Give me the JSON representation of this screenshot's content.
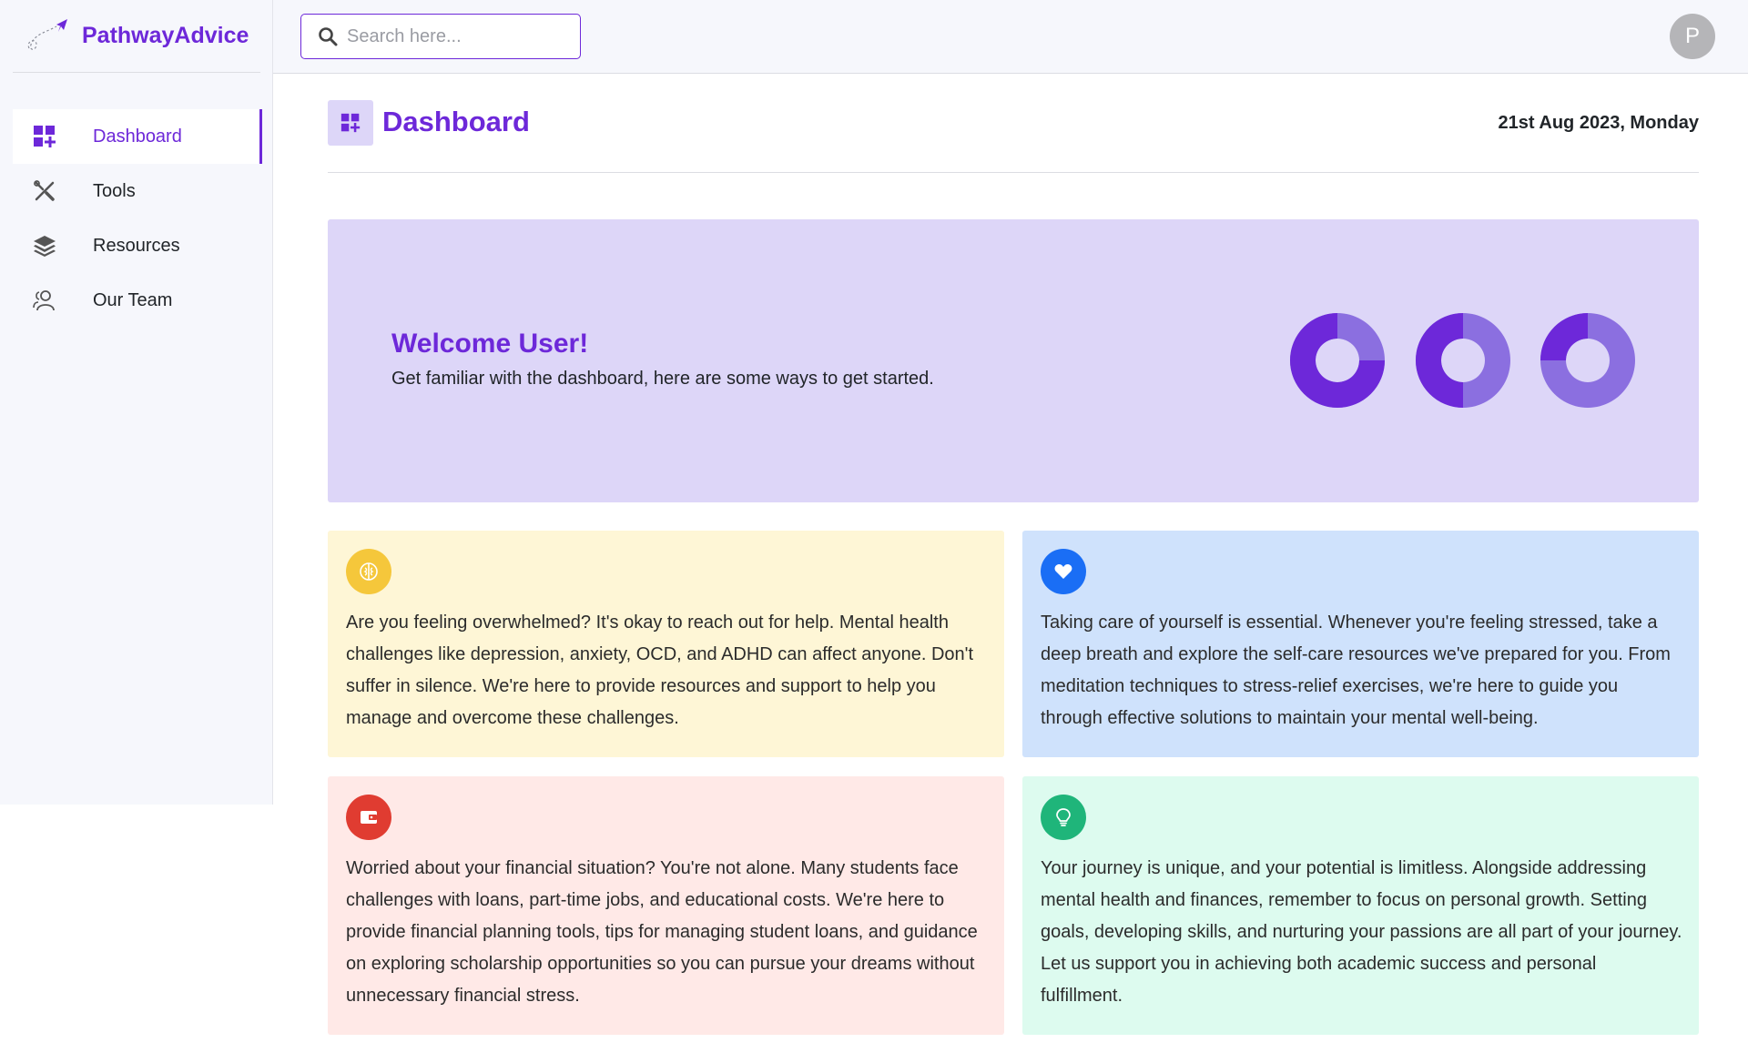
{
  "brand": {
    "name": "PathwayAdvice"
  },
  "sidebar": {
    "items": [
      {
        "label": "Dashboard",
        "icon": "dashboard-icon",
        "active": true
      },
      {
        "label": "Tools",
        "icon": "tools-icon",
        "active": false
      },
      {
        "label": "Resources",
        "icon": "layers-icon",
        "active": false
      },
      {
        "label": "Our Team",
        "icon": "team-icon",
        "active": false
      }
    ]
  },
  "topbar": {
    "search_placeholder": "Search here...",
    "avatar_initial": "P"
  },
  "page": {
    "title": "Dashboard",
    "date": "21st Aug 2023, Monday"
  },
  "welcome": {
    "title": "Welcome User!",
    "subtitle": "Get familiar with the dashboard, here are some ways to get started.",
    "donuts": [
      {
        "dark_fraction": 0.75
      },
      {
        "dark_fraction": 0.5
      },
      {
        "dark_fraction": 0.25
      }
    ]
  },
  "cards": [
    {
      "icon": "brain-icon",
      "icon_color": "#f5c73b",
      "text": "Are you feeling overwhelmed? It's okay to reach out for help. Mental health challenges like depression, anxiety, OCD, and ADHD can affect anyone. Don't suffer in silence. We're here to provide resources and support to help you manage and overcome these challenges."
    },
    {
      "icon": "heart-icon",
      "icon_color": "#1a6ef5",
      "text": "Taking care of yourself is essential. Whenever you're feeling stressed, take a deep breath and explore the self-care resources we've prepared for you. From meditation techniques to stress-relief exercises, we're here to guide you through effective solutions to maintain your mental well-being."
    },
    {
      "icon": "wallet-icon",
      "icon_color": "#e03c31",
      "text": "Worried about your financial situation? You're not alone. Many students face challenges with loans, part-time jobs, and educational costs. We're here to provide financial planning tools, tips for managing student loans, and guidance on exploring scholarship opportunities so you can pursue your dreams without unnecessary financial stress."
    },
    {
      "icon": "lightbulb-icon",
      "icon_color": "#1fb57a",
      "text": "Your journey is unique, and your potential is limitless. Alongside addressing mental health and finances, remember to focus on personal growth. Setting goals, developing skills, and nurturing your passions are all part of your journey. Let us support you in achieving both academic success and personal fulfillment."
    }
  ],
  "colors": {
    "accent": "#6d28d9",
    "donut_dark": "#6d28d9",
    "donut_light": "#8b6fe0"
  }
}
